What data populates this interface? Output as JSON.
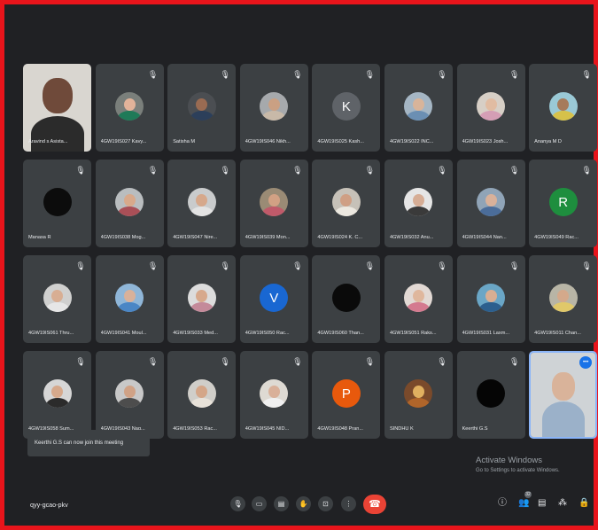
{
  "participants": [
    {
      "name": "Aravind s Asista...",
      "muted": false,
      "type": "video",
      "colors": [
        "#d9d6d0",
        "#6f4a3a",
        "#2b2b2b"
      ]
    },
    {
      "name": "4GW19IS027 Kavy...",
      "muted": true,
      "type": "photo",
      "colors": [
        "#7a7f7b",
        "#1f7a58",
        "#e2b39a"
      ]
    },
    {
      "name": "Satisha M",
      "muted": true,
      "type": "photo",
      "colors": [
        "#4b4e52",
        "#2c3f5a",
        "#9a6b52"
      ]
    },
    {
      "name": "4GW19IS046 Nikh...",
      "muted": true,
      "type": "photo",
      "colors": [
        "#a6a9ac",
        "#c8b9a8",
        "#caa083"
      ]
    },
    {
      "name": "4GW19IS025 Kash...",
      "muted": true,
      "type": "letter",
      "letter": "K",
      "colors": [
        "#5f6368"
      ]
    },
    {
      "name": "4GW19IS022 INC...",
      "muted": true,
      "type": "photo",
      "colors": [
        "#a5b6c4",
        "#6b8fb3",
        "#d8b49a"
      ]
    },
    {
      "name": "4GW19IS023 Josh...",
      "muted": true,
      "type": "photo",
      "colors": [
        "#d7cfc6",
        "#d49eb5",
        "#e1bca2"
      ]
    },
    {
      "name": "Ananya M D",
      "muted": true,
      "type": "photo",
      "colors": [
        "#9ac9d6",
        "#d6c14a",
        "#a67b5b"
      ]
    },
    {
      "name": "Manasa R",
      "muted": true,
      "type": "dark",
      "colors": [
        "#0c0c0c"
      ]
    },
    {
      "name": "4GW19IS038 Mog...",
      "muted": true,
      "type": "photo",
      "colors": [
        "#b9bdbf",
        "#a94f57",
        "#d8a98b"
      ]
    },
    {
      "name": "4GW19IS047 Nire...",
      "muted": true,
      "type": "photo",
      "colors": [
        "#c9cbcc",
        "#e3e3e3",
        "#d6a88b"
      ]
    },
    {
      "name": "4GW19IS039 Mon...",
      "muted": true,
      "type": "photo",
      "colors": [
        "#9a8b75",
        "#c05a6a",
        "#d2a184"
      ]
    },
    {
      "name": "4GW19IS024 K. C...",
      "muted": true,
      "type": "photo",
      "colors": [
        "#c6c1b8",
        "#ece8e0",
        "#cf9f84"
      ]
    },
    {
      "name": "4GW19IS032 Anu...",
      "muted": true,
      "type": "photo",
      "colors": [
        "#e5e5e5",
        "#3a3a3a",
        "#d6ad95"
      ]
    },
    {
      "name": "4GW19IS044 Nan...",
      "muted": true,
      "type": "photo",
      "colors": [
        "#90a4b7",
        "#4b6d9a",
        "#d9b19a"
      ]
    },
    {
      "name": "4GW19IS049 Rac...",
      "muted": true,
      "type": "letter",
      "letter": "R",
      "colors": [
        "#1e8e3e"
      ]
    },
    {
      "name": "4GW19IS061 Thru...",
      "muted": true,
      "type": "photo",
      "colors": [
        "#d0d0cf",
        "#e6e6e6",
        "#d8ae93"
      ]
    },
    {
      "name": "4GW19IS041 Moul...",
      "muted": true,
      "type": "photo",
      "colors": [
        "#8fb6d8",
        "#4a86c5",
        "#d9b19a"
      ]
    },
    {
      "name": "4GW19IS033 Med...",
      "muted": true,
      "type": "photo",
      "colors": [
        "#dcdcdc",
        "#c48a9a",
        "#d7a98c"
      ]
    },
    {
      "name": "4GW19IS050 Rac...",
      "muted": true,
      "type": "letter",
      "letter": "V",
      "colors": [
        "#1967d2"
      ]
    },
    {
      "name": "4GW19IS060 Than...",
      "muted": true,
      "type": "dark",
      "colors": [
        "#0a0a0a"
      ]
    },
    {
      "name": "4GW19IS051 Raks...",
      "muted": true,
      "type": "photo",
      "colors": [
        "#e2d9d4",
        "#d47a8f",
        "#dfb79d"
      ]
    },
    {
      "name": "4GW19IS031 Laxm...",
      "muted": true,
      "type": "photo",
      "colors": [
        "#6aa6c6",
        "#2c5f8e",
        "#d8ae93"
      ]
    },
    {
      "name": "4GW19IS011 Chan...",
      "muted": true,
      "type": "photo",
      "colors": [
        "#b8b5a6",
        "#e0c86a",
        "#d4a98b"
      ]
    },
    {
      "name": "4GW19IS058 Sum...",
      "muted": true,
      "type": "photo",
      "colors": [
        "#d6d6d6",
        "#2b2b2b",
        "#d6a98c"
      ]
    },
    {
      "name": "4GW19IS043 Nag...",
      "muted": true,
      "type": "photo",
      "colors": [
        "#c8c8c8",
        "#4d4d4d",
        "#d0a286"
      ]
    },
    {
      "name": "4GW19IS053 Rac...",
      "muted": true,
      "type": "photo",
      "colors": [
        "#d0cec9",
        "#e8e2d9",
        "#d4a688"
      ]
    },
    {
      "name": "4GW19IS045 NID...",
      "muted": true,
      "type": "photo",
      "colors": [
        "#dedad3",
        "#f0f0f0",
        "#d9b099"
      ]
    },
    {
      "name": "4GW19IS048 Pran...",
      "muted": true,
      "type": "letter",
      "letter": "P",
      "colors": [
        "#e8590c"
      ]
    },
    {
      "name": "SINDHU K",
      "muted": true,
      "type": "photo",
      "colors": [
        "#7a4a2b",
        "#b0652a",
        "#e0b060"
      ]
    },
    {
      "name": "Keerthi G.S",
      "muted": true,
      "type": "dark",
      "colors": [
        "#050505"
      ]
    },
    {
      "name": "",
      "muted": false,
      "type": "self",
      "colors": [
        "#cfd3d6",
        "#9bb1c9",
        "#d9b39a"
      ]
    }
  ],
  "toast": "Keerthi G.S can now join this meeting",
  "activate": {
    "title": "Activate Windows",
    "subtitle": "Go to Settings to activate Windows."
  },
  "meeting_code": "qyy-gcao-pkv",
  "people_count": "32",
  "controls": [
    {
      "name": "mic-button",
      "glyph": "🎙"
    },
    {
      "name": "camera-button",
      "glyph": "▭"
    },
    {
      "name": "captions-button",
      "glyph": "▤"
    },
    {
      "name": "raise-hand-button",
      "glyph": "✋"
    },
    {
      "name": "present-button",
      "glyph": "⊡"
    },
    {
      "name": "more-options-button",
      "glyph": "⋮"
    }
  ],
  "end_call_glyph": "☎",
  "right_icons": [
    {
      "name": "meeting-details-icon",
      "glyph": "ⓘ"
    },
    {
      "name": "people-icon",
      "glyph": "👥"
    },
    {
      "name": "chat-icon",
      "glyph": "▤"
    },
    {
      "name": "activities-icon",
      "glyph": "⁂"
    },
    {
      "name": "host-controls-icon",
      "glyph": "🔒"
    }
  ],
  "mic_off_glyph": "🎙",
  "more_glyph": "•••"
}
